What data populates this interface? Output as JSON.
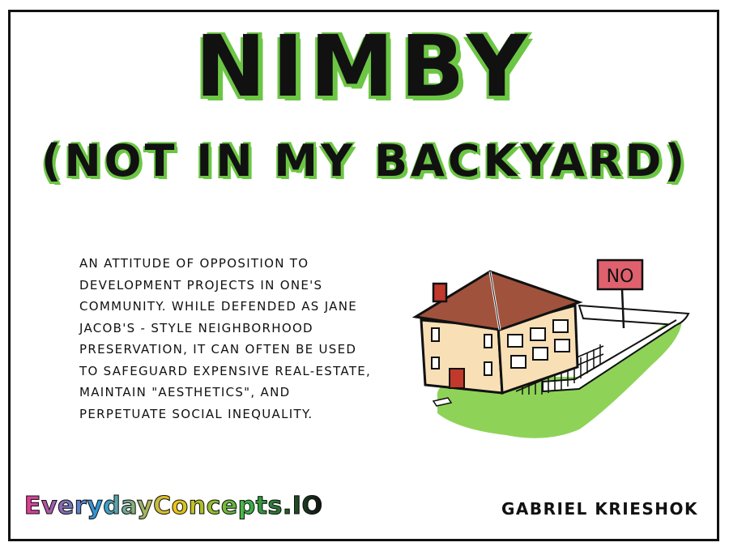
{
  "title": "NIMBY",
  "subtitle": "(NOT IN MY BACKYARD)",
  "description": "An attitude of opposition to development projects in one's community. While defended as Jane Jacob's - style neighborhood preservation, it can often be used to safeguard expensive real-estate, maintain \"aesthetics\", and perpetuate social inequality.",
  "sign_text": "NO",
  "brand": "EverydayConcepts.IO",
  "author": "Gabriel Krieshok",
  "colors": {
    "accent_green": "#6cc644",
    "roof": "#a0523d",
    "wall": "#f9dfb5",
    "door": "#c0392b",
    "sign": "#e0616e",
    "ink": "#111111"
  }
}
